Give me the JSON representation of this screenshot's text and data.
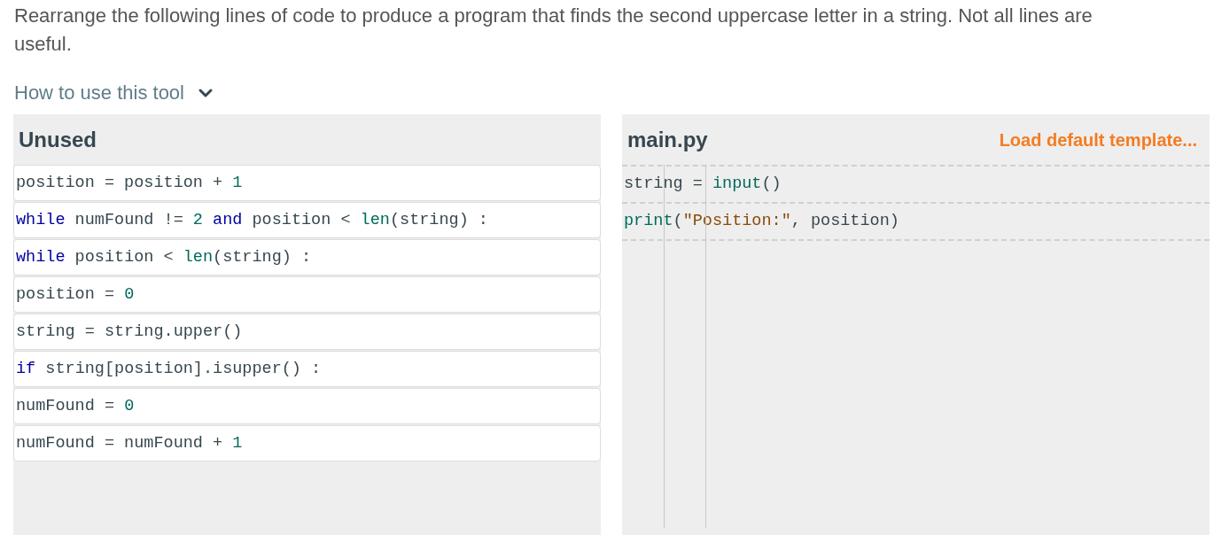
{
  "instructions": "Rearrange the following lines of code to produce a program that finds the second uppercase letter in a string. Not all lines are useful.",
  "help_toggle": {
    "label": "How to use this tool",
    "expanded": false
  },
  "unused": {
    "title": "Unused",
    "lines": [
      [
        {
          "kind": "plain",
          "text": "position = position + "
        },
        {
          "kind": "num",
          "text": "1"
        }
      ],
      [
        {
          "kind": "kw",
          "text": "while"
        },
        {
          "kind": "plain",
          "text": " numFound != "
        },
        {
          "kind": "num",
          "text": "2"
        },
        {
          "kind": "kw",
          "text": " and"
        },
        {
          "kind": "plain",
          "text": " position < "
        },
        {
          "kind": "fn",
          "text": "len"
        },
        {
          "kind": "plain",
          "text": "(string) :"
        }
      ],
      [
        {
          "kind": "kw",
          "text": "while"
        },
        {
          "kind": "plain",
          "text": " position < "
        },
        {
          "kind": "fn",
          "text": "len"
        },
        {
          "kind": "plain",
          "text": "(string) :"
        }
      ],
      [
        {
          "kind": "plain",
          "text": "position = "
        },
        {
          "kind": "num",
          "text": "0"
        }
      ],
      [
        {
          "kind": "plain",
          "text": "string = string.upper()"
        }
      ],
      [
        {
          "kind": "kw",
          "text": "if"
        },
        {
          "kind": "plain",
          "text": " string[position].isupper() :"
        }
      ],
      [
        {
          "kind": "plain",
          "text": "numFound = "
        },
        {
          "kind": "num",
          "text": "0"
        }
      ],
      [
        {
          "kind": "plain",
          "text": "numFound = numFound + "
        },
        {
          "kind": "num",
          "text": "1"
        }
      ]
    ]
  },
  "program": {
    "title": "main.py",
    "template_link": "Load default template...",
    "lines": [
      [
        {
          "kind": "plain",
          "text": "string = "
        },
        {
          "kind": "fn",
          "text": "input"
        },
        {
          "kind": "plain",
          "text": "()"
        }
      ],
      [
        {
          "kind": "fn",
          "text": "print"
        },
        {
          "kind": "plain",
          "text": "("
        },
        {
          "kind": "str",
          "text": "\"Position:\""
        },
        {
          "kind": "plain",
          "text": ", position)"
        }
      ]
    ]
  }
}
